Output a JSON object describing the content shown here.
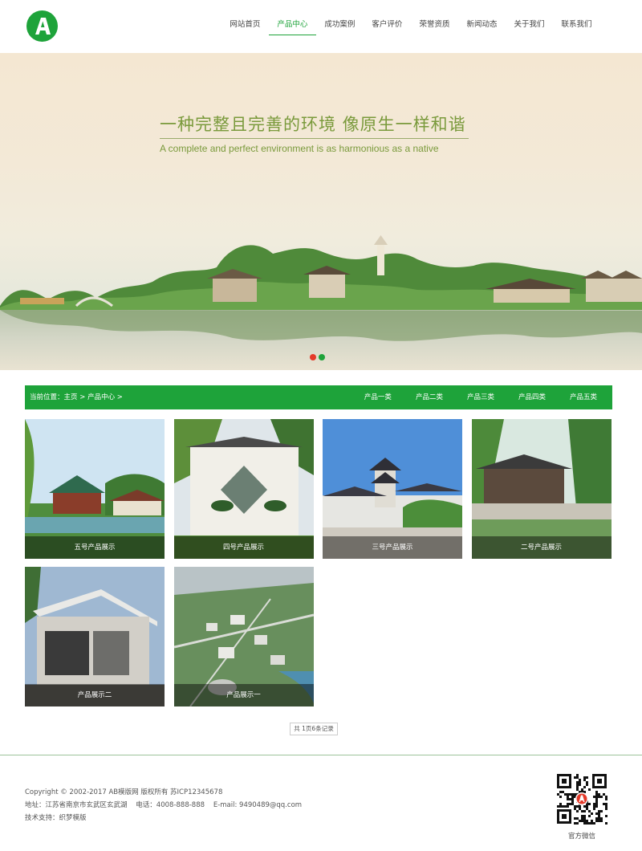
{
  "header": {
    "logo_letter": "A",
    "nav": [
      {
        "label": "网站首页",
        "active": false
      },
      {
        "label": "产品中心",
        "active": true
      },
      {
        "label": "成功案例",
        "active": false
      },
      {
        "label": "客户评价",
        "active": false
      },
      {
        "label": "荣誉资质",
        "active": false
      },
      {
        "label": "新闻动态",
        "active": false
      },
      {
        "label": "关于我们",
        "active": false
      },
      {
        "label": "联系我们",
        "active": false
      }
    ]
  },
  "banner": {
    "headline": "一种完整且完善的环境  像原生一样和谐",
    "subline": "A complete and perfect environment is as harmonious as a native",
    "slide_count": 2,
    "active_slide": 1
  },
  "category_bar": {
    "breadcrumb_prefix": "当前位置：",
    "breadcrumb_home": "主页",
    "breadcrumb_sep": " > ",
    "breadcrumb_current": "产品中心",
    "breadcrumb_tail": " >",
    "categories": [
      "产品一类",
      "产品二类",
      "产品三类",
      "产品四类",
      "产品五类"
    ]
  },
  "products": [
    {
      "title": "五号产品展示",
      "scene": "pavilion-garden"
    },
    {
      "title": "四号产品展示",
      "scene": "bonsai-wall"
    },
    {
      "title": "三号产品展示",
      "scene": "pagoda-buildings"
    },
    {
      "title": "二号产品展示",
      "scene": "lake-pavilion"
    },
    {
      "title": "产品展示二",
      "scene": "modern-villa"
    },
    {
      "title": "产品展示一",
      "scene": "city-aerial"
    }
  ],
  "pager": {
    "text": "共 1页6条记录"
  },
  "footer": {
    "copyright": "Copyright © 2002-2017 AB模版网 版权所有 苏ICP12345678",
    "address": "地址：江苏省南京市玄武区玄武湖    电话：4008-888-888    E-mail: 9490489@qq.com",
    "support": "技术支持：织梦模版",
    "qr_label": "官方微信"
  },
  "colors": {
    "brand_green": "#1ea33a",
    "headline_green": "#7a9a3c",
    "active_dot": "#e53a2a"
  }
}
